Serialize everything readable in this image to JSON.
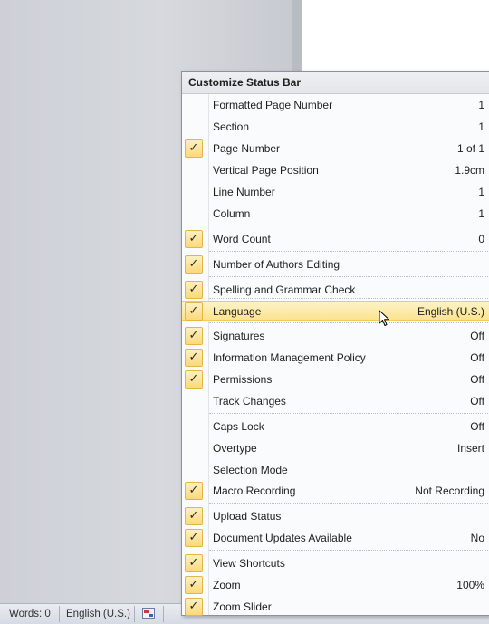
{
  "status_bar": {
    "words": "Words: 0",
    "language": "English (U.S.)",
    "layout_icon": "document-layout-icon"
  },
  "menu": {
    "title": "Customize Status Bar",
    "items": [
      {
        "label": "Formatted Page Number",
        "value": "1",
        "checked": false,
        "icon": ""
      },
      {
        "label": "Section",
        "value": "1",
        "checked": false,
        "icon": ""
      },
      {
        "label": "Page Number",
        "value": "1 of 1",
        "checked": true,
        "icon": "checkmark-icon"
      },
      {
        "label": "Vertical Page Position",
        "value": "1.9cm",
        "checked": false,
        "icon": ""
      },
      {
        "label": "Line Number",
        "value": "1",
        "checked": false,
        "icon": ""
      },
      {
        "label": "Column",
        "value": "1",
        "checked": false,
        "icon": ""
      },
      {
        "label": "Word Count",
        "value": "0",
        "checked": true,
        "icon": "checkmark-icon"
      },
      {
        "label": "Number of Authors Editing",
        "value": "",
        "checked": true,
        "icon": "checkmark-icon"
      },
      {
        "label": "Spelling and Grammar Check",
        "value": "",
        "checked": true,
        "icon": "checkmark-icon"
      },
      {
        "label": "Language",
        "value": "English (U.S.)",
        "checked": true,
        "icon": "checkmark-icon",
        "hover": true
      },
      {
        "label": "Signatures",
        "value": "Off",
        "checked": true,
        "icon": "checkmark-icon"
      },
      {
        "label": "Information Management Policy",
        "value": "Off",
        "checked": true,
        "icon": "checkmark-icon"
      },
      {
        "label": "Permissions",
        "value": "Off",
        "checked": true,
        "icon": "checkmark-icon"
      },
      {
        "label": "Track Changes",
        "value": "Off",
        "checked": false,
        "icon": ""
      },
      {
        "label": "Caps Lock",
        "value": "Off",
        "checked": false,
        "icon": ""
      },
      {
        "label": "Overtype",
        "value": "Insert",
        "checked": false,
        "icon": ""
      },
      {
        "label": "Selection Mode",
        "value": "",
        "checked": false,
        "icon": ""
      },
      {
        "label": "Macro Recording",
        "value": "Not Recording",
        "checked": true,
        "icon": "checkmark-icon"
      },
      {
        "label": "Upload Status",
        "value": "",
        "checked": true,
        "icon": "checkmark-icon"
      },
      {
        "label": "Document Updates Available",
        "value": "No",
        "checked": true,
        "icon": "checkmark-icon"
      },
      {
        "label": "View Shortcuts",
        "value": "",
        "checked": true,
        "icon": "checkmark-icon"
      },
      {
        "label": "Zoom",
        "value": "100%",
        "checked": true,
        "icon": "checkmark-icon"
      },
      {
        "label": "Zoom Slider",
        "value": "",
        "checked": true,
        "icon": "checkmark-icon"
      }
    ]
  },
  "icons": {
    "check_glyph": "✓",
    "cursor": "mouse-pointer-icon"
  },
  "colors": {
    "hover_top": "#fdf3c8",
    "hover_bottom": "#fbe38f",
    "check_border": "#e5b547"
  }
}
